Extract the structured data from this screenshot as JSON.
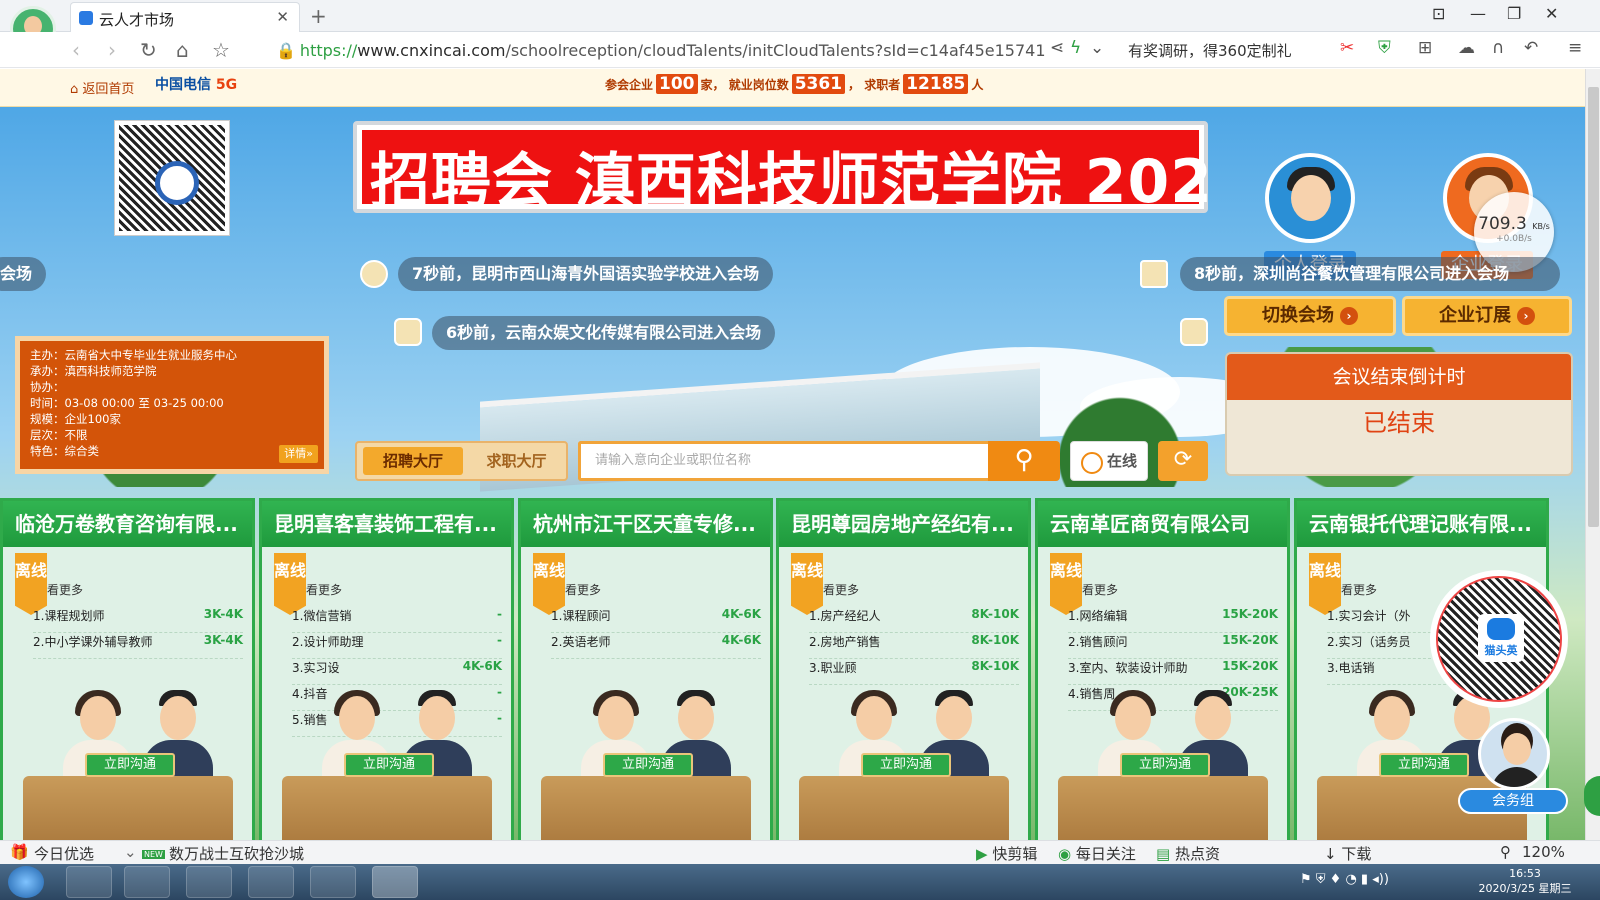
{
  "browser": {
    "tab_title": "云人才市场",
    "url_scheme": "https://",
    "url_host": "www.cnxincai.com",
    "url_path": "/schoolreception/cloudTalents/initCloudTalents?sId=c14af45e15741",
    "right_text": "有奖调研，得360定制礼",
    "zoom": "120%"
  },
  "site": {
    "back_home": "返回首页",
    "telecom_label": "中国电信",
    "five_g": "5G",
    "stats_prefix": "参会企业",
    "companies": "100",
    "stats_mid1": "家， 就业岗位数",
    "jobs": "5361",
    "stats_mid2": "， 求职者",
    "seekers": "12185",
    "stats_suffix": "人"
  },
  "banner_text": "招聘会 滇西科技师范学院 202",
  "login": {
    "personal": "个人登录",
    "enterprise": "企业登录"
  },
  "speed": {
    "value": "709.3",
    "unit": "KB/s",
    "delta": "+0.0B/s"
  },
  "tickers": [
    {
      "text": "会场"
    },
    {
      "text": "7秒前，昆明市西山海青外国语实验学校进入会场"
    },
    {
      "text": "8秒前，深圳尚谷餐饮管理有限公司进入会场"
    },
    {
      "text": "6秒前，云南众娱文化传媒有限公司进入会场"
    }
  ],
  "actions": {
    "switch_venue": "切换会场",
    "subscribe": "企业订展"
  },
  "countdown": {
    "title": "会议结束倒计时",
    "status": "已结束"
  },
  "info": {
    "host": "主办：云南省大中专毕业生就业服务中心",
    "organizer": "承办：滇西科技师范学院",
    "co": "协办：",
    "time": "时间：03-08 00:00 至 03-25 00:00",
    "scale": "规模：企业100家",
    "level": "层次：不限",
    "feature": "特色：综合类",
    "detail": "详情"
  },
  "hall": {
    "recruit": "招聘大厅",
    "jobseek": "求职大厅"
  },
  "search": {
    "placeholder": "请输入意向企业或职位名称"
  },
  "online_label": "在线",
  "booths": [
    {
      "name": "临沧万卷教育咨询有限...",
      "badge": "离线",
      "more": "看更多",
      "jobs": [
        {
          "t": "1.课程规划师",
          "s": "3K-4K"
        },
        {
          "t": "2.中小学课外辅导教师",
          "s": "3K-4K"
        }
      ]
    },
    {
      "name": "昆明喜客喜装饰工程有...",
      "badge": "离线",
      "more": "看更多",
      "jobs": [
        {
          "t": "1.微信营销",
          "s": "-"
        },
        {
          "t": "2.设计师助理",
          "s": "-"
        },
        {
          "t": "3.实习设",
          "s": "4K-6K"
        },
        {
          "t": "4.抖音",
          "s": "-"
        },
        {
          "t": "5.销售",
          "s": "-"
        }
      ]
    },
    {
      "name": "杭州市江干区天童专修...",
      "badge": "离线",
      "more": "看更多",
      "jobs": [
        {
          "t": "1.课程顾问",
          "s": "4K-6K"
        },
        {
          "t": "2.英语老师",
          "s": "4K-6K"
        }
      ]
    },
    {
      "name": "昆明尊园房地产经纪有...",
      "badge": "离线",
      "more": "看更多",
      "jobs": [
        {
          "t": "1.房产经纪人",
          "s": "8K-10K"
        },
        {
          "t": "2.房地产销售",
          "s": "8K-10K"
        },
        {
          "t": "3.职业顾",
          "s": "8K-10K"
        }
      ]
    },
    {
      "name": "云南革匠商贸有限公司",
      "badge": "离线",
      "more": "看更多",
      "jobs": [
        {
          "t": "1.网络编辑",
          "s": "15K-20K"
        },
        {
          "t": "2.销售顾问",
          "s": "15K-20K"
        },
        {
          "t": "3.室内、软装设计师助",
          "s": "15K-20K"
        },
        {
          "t": "4.销售周",
          "s": "20K-25K"
        }
      ]
    },
    {
      "name": "云南银托代理记账有限...",
      "badge": "离线",
      "more": "看更多",
      "jobs": [
        {
          "t": "1.实习会计（外",
          "s": ""
        },
        {
          "t": "2.实习（话务员",
          "s": ""
        },
        {
          "t": "3.电话销",
          "s": ""
        }
      ]
    }
  ],
  "chat_button": "立即沟通",
  "qr2_label": "猫头英",
  "agent_label": "会务组",
  "statusbar": {
    "today": "今日优选",
    "news": "数万战士互砍抢沙城",
    "new_tag": "NEW",
    "quick_edit": "快剪辑",
    "daily": "每日关注",
    "hot": "热点资",
    "download": "下载",
    "zoom": "120%"
  },
  "taskbar": {
    "time": "16:53",
    "date": "2020/3/25 星期三"
  }
}
